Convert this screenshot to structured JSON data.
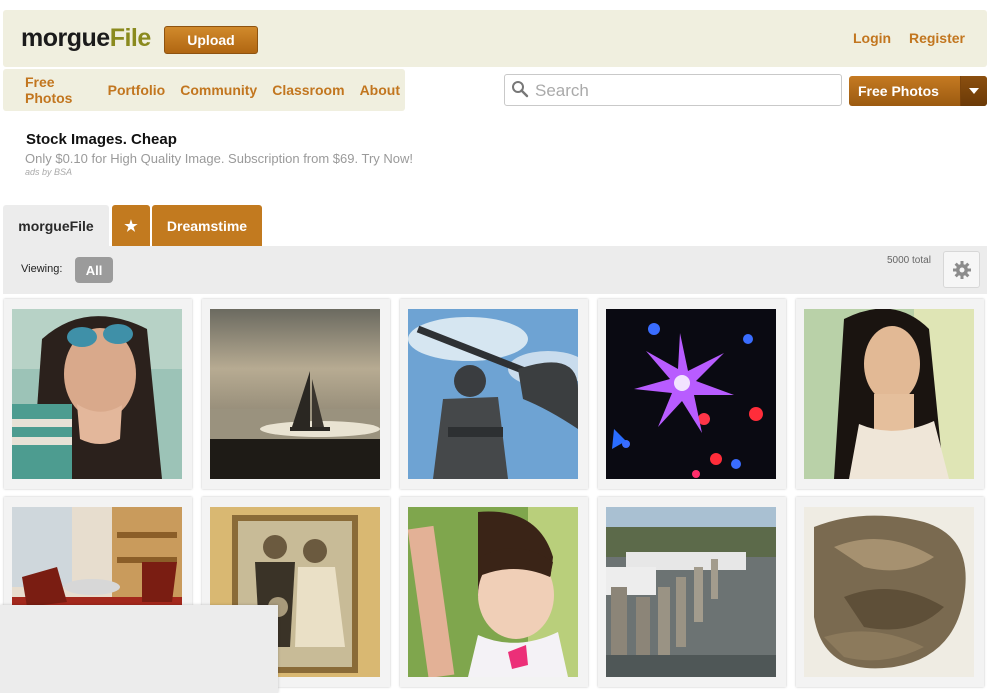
{
  "header": {
    "logo_morgue": "morgue",
    "logo_file": "File",
    "upload_label": "Upload",
    "login_label": "Login",
    "register_label": "Register"
  },
  "nav": {
    "items": [
      "Free Photos",
      "Portfolio",
      "Community",
      "Classroom",
      "About"
    ]
  },
  "search": {
    "placeholder": "Search",
    "scope_selected": "Free Photos"
  },
  "ad": {
    "title": "Stock Images. Cheap",
    "text": "Only $0.10 for High Quality Image. Subscription from $69. Try Now!",
    "by": "ads by BSA"
  },
  "tabs": {
    "morguefile": "morgueFile",
    "star": "★",
    "dreamstime": "Dreamstime"
  },
  "viewing": {
    "label": "Viewing:",
    "filter": "All",
    "total": "5000 total"
  },
  "photos": [
    {
      "subject": "woman-with-sunglasses"
    },
    {
      "subject": "sailboat-sunset"
    },
    {
      "subject": "statue-with-sky"
    },
    {
      "subject": "star-lights"
    },
    {
      "subject": "woman-portrait"
    },
    {
      "subject": "living-room"
    },
    {
      "subject": "vintage-couple-photo"
    },
    {
      "subject": "little-girl"
    },
    {
      "subject": "harbor-pier"
    },
    {
      "subject": "dried-leaves"
    }
  ],
  "colors": {
    "accent": "#c2761f",
    "header_bg": "#f0efdf",
    "tab_bg": "#c27a1f",
    "bar_bg": "#ececec"
  }
}
